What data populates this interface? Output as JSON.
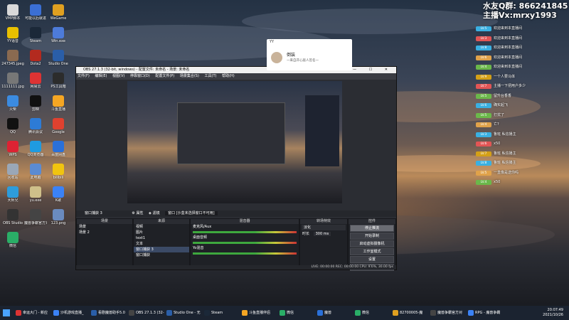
{
  "desktop": {
    "icons": [
      {
        "label": "VMP脚本",
        "color": "#d9d9d9"
      },
      {
        "label": "可能以后就进",
        "color": "#3b6fd4"
      },
      {
        "label": "WeGame",
        "color": "#e0a020"
      },
      {
        "label": "YY语音",
        "color": "#e8c000"
      },
      {
        "label": "Steam",
        "color": "#1b2838"
      },
      {
        "label": "Win.exe",
        "color": "#4d7bd9"
      },
      {
        "label": "247345.jpeg",
        "color": "#8a6a50"
      },
      {
        "label": "Dota2",
        "color": "#b32a1f"
      },
      {
        "label": "Studio One",
        "color": "#2a5ea8"
      },
      {
        "label": "1111111.jpg",
        "color": "#777"
      },
      {
        "label": "网易云",
        "color": "#d33"
      },
      {
        "label": "PS工具箱",
        "color": "#2c2c2c"
      },
      {
        "label": "火柴",
        "color": "#3b8be0"
      },
      {
        "label": "剪映",
        "color": "#111"
      },
      {
        "label": "斗鱼直播",
        "color": "#f5a623"
      },
      {
        "label": "QQ",
        "color": "#111"
      },
      {
        "label": "腾讯会议",
        "color": "#2d7bd6"
      },
      {
        "label": "Google",
        "color": "#e0412f"
      },
      {
        "label": "WPS",
        "color": "#d23"
      },
      {
        "label": "QQ浏览器",
        "color": "#1f9be0"
      },
      {
        "label": "百度网盘",
        "color": "#2a70d9"
      },
      {
        "label": "回收站",
        "color": "#9aa7b7"
      },
      {
        "label": "此电脑",
        "color": "#5b8bd2"
      },
      {
        "label": "bilibili",
        "color": "#f1c40f"
      },
      {
        "label": "大师兄",
        "color": "#2d9cdb"
      },
      {
        "label": "yu.exe",
        "color": "#cfc08a"
      },
      {
        "label": "K歌",
        "color": "#3b82f6"
      },
      {
        "label": "OBS Studio",
        "color": "#333"
      },
      {
        "label": "魔兽争霸官方对战平台",
        "color": "#444"
      },
      {
        "label": "123.png",
        "color": "#6a8bbf"
      },
      {
        "label": "微信",
        "color": "#2aae67"
      }
    ]
  },
  "obs": {
    "title": "OBS 27.1.3 (32-bit, windows) - 配置文件: 未命名 - 场景: 未命名",
    "controls": "—  ☐  ✕",
    "menu": [
      "文件(F)",
      "编辑(E)",
      "视图(V)",
      "停靠窗口(D)",
      "配置文件(P)",
      "场景集合(S)",
      "工具(T)",
      "帮助(H)"
    ],
    "source_name": "窗口捕获 3",
    "source_props": "⚙ 属性",
    "source_filters": "◈ 滤镜",
    "source_window": "窗口 [沙盒未选择窗口不可用]",
    "docks": {
      "scenes": {
        "title": "场景",
        "items": [
          "场景",
          "场景 2"
        ]
      },
      "sources": {
        "title": "来源",
        "items": [
          "视频",
          "图片",
          "text1",
          "文本",
          "窗口捕获 3",
          "窗口捕获"
        ]
      },
      "mixer": {
        "title": "混音器",
        "channels": [
          {
            "name": "麦克风/Aux",
            "db": "0.0 dB"
          },
          {
            "name": "桌面音频",
            "db": "0.0 dB"
          },
          {
            "name": "Yo混音",
            "db": "0.0 dB"
          }
        ]
      },
      "transitions": {
        "title": "转场特效",
        "type": "淡化",
        "duration_label": "时长",
        "duration": "300 ms"
      },
      "controls": {
        "title": "控件",
        "buttons": [
          "停止推流",
          "开始录制",
          "启动虚拟摄像机",
          "工作室模式",
          "设置",
          "退出"
        ]
      }
    },
    "status": "LIVE: 00:00:00   REC: 00:00:00   CPU: 9.6%, 30.00 fps"
  },
  "yy_card": {
    "app": "YY",
    "name": "倒装",
    "signature": "一来自开心敲人签名一"
  },
  "chat": {
    "qq_group": "水友Q群: 866241845",
    "host_vx": "主播Vx:mrxy1993",
    "messages": [
      {
        "level": "LV.5",
        "color": "#3ab0e2",
        "text": "欢迎来到本直播间"
      },
      {
        "level": "LV.3",
        "color": "#e25555",
        "text": "欢迎来到本直播间"
      },
      {
        "level": "LV.8",
        "color": "#3ab0e2",
        "text": "欢迎来到本直播间"
      },
      {
        "level": "LV.6",
        "color": "#e0a24a",
        "text": "欢迎来到本直播间"
      },
      {
        "level": "LV.4",
        "color": "#6bb84a",
        "text": "欢迎来到本直播间"
      },
      {
        "level": "LV.9",
        "color": "#d4a017",
        "text": "一个人要马体"
      },
      {
        "level": "LV.7",
        "color": "#e25555",
        "text": "主播一下把用户多少"
      },
      {
        "level": "LV.5",
        "color": "#6bb84a",
        "text": "留升台香香"
      },
      {
        "level": "LV.6",
        "color": "#3ab0e2",
        "text": "确实起飞"
      },
      {
        "level": "LV.5",
        "color": "#6bb84a",
        "text": "打扰了"
      },
      {
        "level": "LV.4",
        "color": "#e0a24a",
        "text": "亡?"
      },
      {
        "level": "LV.3",
        "color": "#3ab0e2",
        "text": "鲁班 私信播主"
      },
      {
        "level": "LV.6",
        "color": "#e25555",
        "text": "x50"
      },
      {
        "level": "LV.7",
        "color": "#d4a017",
        "text": "鲁班 私信播主"
      },
      {
        "level": "LV.8",
        "color": "#3ab0e2",
        "text": "鲁班 私信播主"
      },
      {
        "level": "LV.5",
        "color": "#e0a24a",
        "text": "一直像是送你吗"
      },
      {
        "level": "LV.4",
        "color": "#6bb84a",
        "text": "x50"
      }
    ]
  },
  "taskbar": {
    "items": [
      {
        "label": "幸运大门 - 新应",
        "color": "#d33"
      },
      {
        "label": "沙机游戏直播_",
        "color": "#3b82f6"
      },
      {
        "label": "看剧魔兽助手5.0",
        "color": "#2a5ea8"
      },
      {
        "label": "OBS 27.1.3 (32-",
        "color": "#444"
      },
      {
        "label": "Studio One - 无",
        "color": "#2a5ea8"
      },
      {
        "label": "Steam",
        "color": "#1b2838"
      },
      {
        "label": "斗鱼直播伴侣",
        "color": "#f5a623"
      },
      {
        "label": "微信",
        "color": "#2aae67"
      },
      {
        "label": "魔兽",
        "color": "#2a70d9"
      },
      {
        "label": "微信",
        "color": "#2aae67"
      },
      {
        "label": "82700005-魔",
        "color": "#e0a020"
      },
      {
        "label": "魔兽争霸官方对",
        "color": "#444"
      },
      {
        "label": "RPG - 魔兽争霸",
        "color": "#3b82f6"
      }
    ],
    "time": "20:07:49",
    "date": "2021/10/26"
  }
}
